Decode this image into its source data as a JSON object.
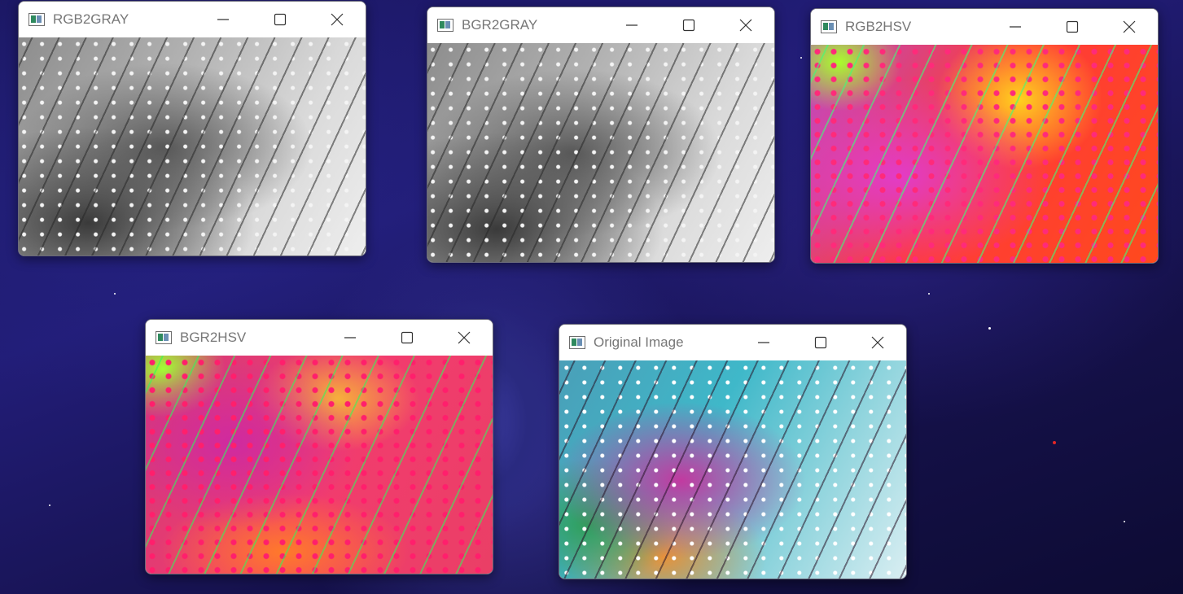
{
  "desktop": {
    "background_colors": [
      "#1a1660",
      "#221d78",
      "#0d0b33"
    ]
  },
  "windows": [
    {
      "id": "rgb2gray",
      "title": "RGB2GRAY",
      "image_kind": "grayscale"
    },
    {
      "id": "bgr2gray",
      "title": "BGR2GRAY",
      "image_kind": "grayscale"
    },
    {
      "id": "rgb2hsv",
      "title": "RGB2HSV",
      "image_kind": "hsv-false-color"
    },
    {
      "id": "bgr2hsv",
      "title": "BGR2HSV",
      "image_kind": "hsv-false-color"
    },
    {
      "id": "original",
      "title": "Original Image",
      "image_kind": "color-photo"
    }
  ],
  "window_controls": {
    "minimize_icon": "minimize-icon",
    "maximize_icon": "maximize-icon",
    "close_icon": "close-icon"
  },
  "colors": {
    "titlebar": "#ffffff",
    "title_text": "#777777",
    "control_glyph": "#333333"
  }
}
